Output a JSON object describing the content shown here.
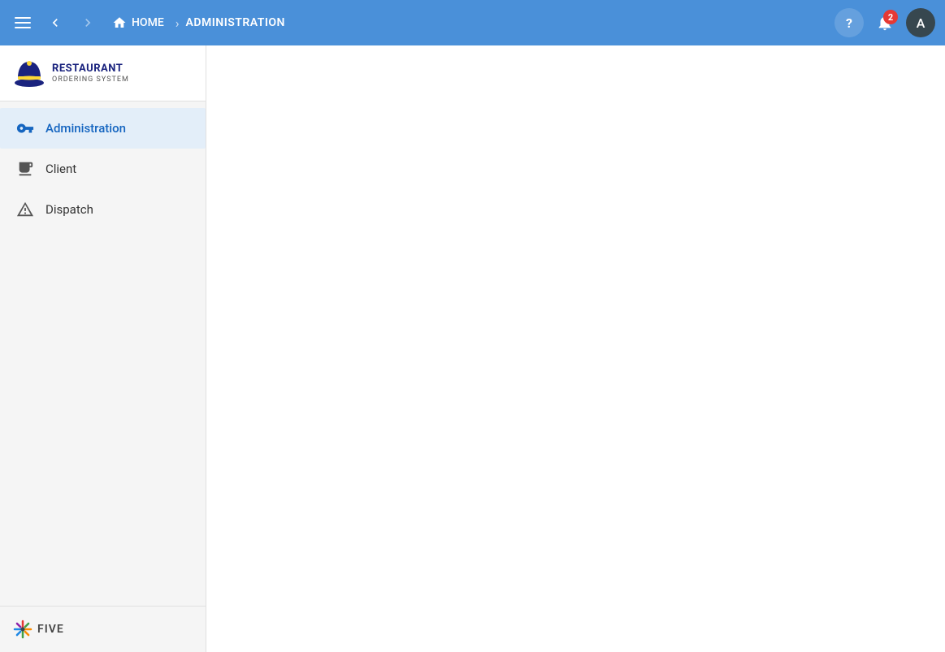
{
  "topbar": {
    "home_label": "HOME",
    "current_page": "ADMINISTRATION",
    "notification_count": "2",
    "avatar_letter": "A",
    "help_label": "?"
  },
  "sidebar": {
    "logo": {
      "restaurant": "RESTAURANT",
      "ordering": "ORDERING SYSTEM"
    },
    "nav_items": [
      {
        "id": "administration",
        "label": "Administration",
        "active": true
      },
      {
        "id": "client",
        "label": "Client",
        "active": false
      },
      {
        "id": "dispatch",
        "label": "Dispatch",
        "active": false
      }
    ],
    "footer": {
      "logo_text": "FIVE"
    }
  }
}
